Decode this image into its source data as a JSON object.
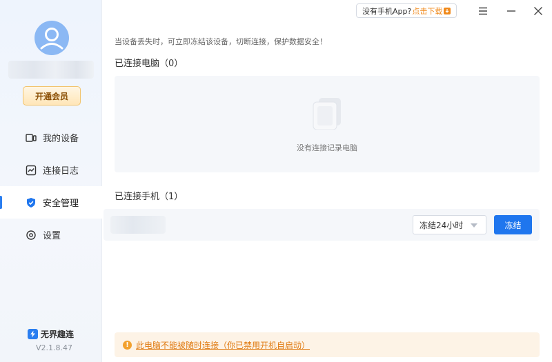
{
  "sidebar": {
    "vip_label": "开通会员",
    "items": [
      {
        "label": "我的设备",
        "icon": "devices-icon"
      },
      {
        "label": "连接日志",
        "icon": "log-icon"
      },
      {
        "label": "安全管理",
        "icon": "shield-icon",
        "active": true
      },
      {
        "label": "设置",
        "icon": "gear-icon"
      }
    ],
    "brand": "无界趣连",
    "version": "V2.1.8.47"
  },
  "topbar": {
    "promo_text": "没有手机App?",
    "promo_download": "点击下载"
  },
  "main": {
    "hint": "当设备丢失时，可立即冻结该设备，切断连接，保护数据安全！",
    "pc_section_title": "已连接电脑（0）",
    "pc_empty_text": "没有连接记录电脑",
    "phone_section_title": "已连接手机（1）",
    "freeze_select_value": "冻结24小时",
    "freeze_button": "冻结",
    "warning_text": "此电脑不能被随时连接（你已禁用开机自启动）"
  },
  "colors": {
    "accent": "#1f76ee",
    "warning": "#e07a10",
    "vip_bg": "#ffe6b8"
  }
}
